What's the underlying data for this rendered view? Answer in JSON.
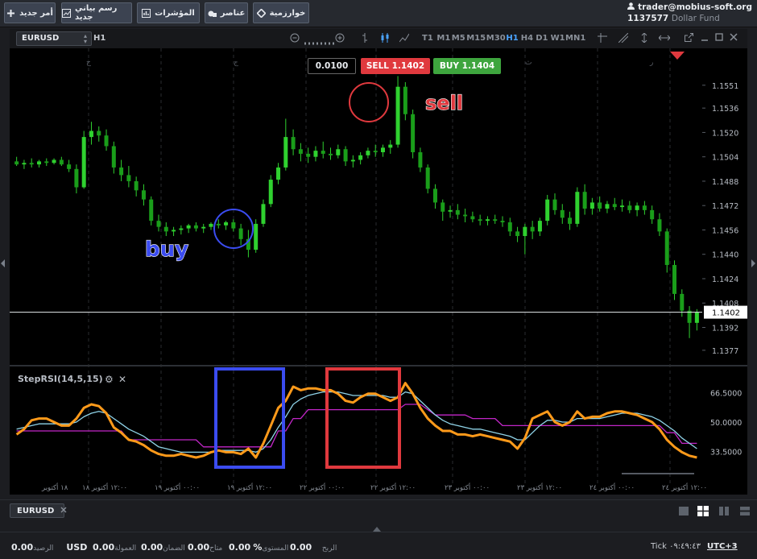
{
  "topbar": {
    "buttons": [
      {
        "label": "أمر جديد",
        "icon": "plus-icon"
      },
      {
        "label": "رسم بياني جديد",
        "icon": "chart-window-icon"
      },
      {
        "label": "المؤشرات",
        "icon": "bar-chart-icon"
      },
      {
        "label": "عناصر",
        "icon": "shapes-icon"
      },
      {
        "label": "خوارزمية",
        "icon": "diamond-icon"
      }
    ],
    "account": {
      "user": "trader@mobius-soft.org",
      "balance": "1137577",
      "fund": "Dollar Fund"
    }
  },
  "chart_toolbar": {
    "symbol": "EURUSD",
    "period": "H1",
    "timeframes": [
      "T1",
      "M1",
      "M5",
      "M15",
      "M30",
      "H1",
      "H4",
      "D1",
      "W1",
      "MN1"
    ],
    "active_timeframe": "H1"
  },
  "order": {
    "lot": "0.0100",
    "sell_label": "SELL 1.1402",
    "buy_label": "BUY 1.1404",
    "sell_color": "#e0393e",
    "buy_color": "#3ea53e"
  },
  "price_axis": {
    "ticks": [
      "1.1551",
      "1.1536",
      "1.1520",
      "1.1504",
      "1.1488",
      "1.1472",
      "1.1456",
      "1.1440",
      "1.1424",
      "1.1408",
      "1.1392",
      "1.1377"
    ],
    "current_price": "1.1402"
  },
  "annotations": {
    "buy": "buy",
    "sell": "sell",
    "buy_color": "#3b4cf0",
    "sell_color": "#e0393e"
  },
  "indicator": {
    "name": "StepRSI(14,5,15)",
    "levels": [
      "66.5000",
      "50.0000",
      "33.5000"
    ]
  },
  "time_axis": [
    "١٨ أكتوبر",
    "١٢:٠٠ أكتوبر ١٨",
    "٠٠:٠٠ أكتوبر ١٩",
    "١٢:٠٠ أكتوبر ١٩",
    "٠٠:٠٠ أكتوبر ٢٢",
    "١٢:٠٠ أكتوبر ٢٢",
    "٠٠:٠٠ أكتوبر ٢٣",
    "١٢:٠٠ أكتوبر ٢٣",
    "٠٠:٠٠ أكتوبر ٢٤",
    "١٢:٠٠ أكتوبر ٢٤"
  ],
  "day_markers": [
    "خ",
    "ج",
    "ن",
    "ث",
    "ر"
  ],
  "tabs": [
    {
      "label": "EURUSD"
    }
  ],
  "status": {
    "balance_label": "الرصيد",
    "balance": "0.00",
    "currency": "USD",
    "commission_label": "العمولة",
    "commission": "0.00",
    "margin_label": "الضمان",
    "margin": "0.00",
    "free_label": "متاح",
    "free": "0.00",
    "level_label": "المستوى",
    "level": "%",
    "profit_label": "الربح",
    "profit": "0.00",
    "tick_label": "Tick",
    "tick_time": "٠٩:٤٩:٤٣",
    "timezone": "UTC+3"
  },
  "chart_data": {
    "type": "candlestick",
    "symbol": "EURUSD",
    "timeframe": "H1",
    "ylim": [
      1.1369,
      1.1562
    ],
    "candles": [
      [
        1.1501,
        1.1504,
        1.1498,
        1.1499
      ],
      [
        1.1499,
        1.1502,
        1.1496,
        1.15
      ],
      [
        1.15,
        1.1503,
        1.1497,
        1.1499
      ],
      [
        1.1499,
        1.1502,
        1.1497,
        1.1501
      ],
      [
        1.1501,
        1.1503,
        1.1498,
        1.15
      ],
      [
        1.15,
        1.1503,
        1.1499,
        1.1502
      ],
      [
        1.1502,
        1.1504,
        1.1498,
        1.1499
      ],
      [
        1.1499,
        1.1502,
        1.1494,
        1.1496
      ],
      [
        1.1496,
        1.1499,
        1.148,
        1.1484
      ],
      [
        1.1484,
        1.1521,
        1.1483,
        1.1517
      ],
      [
        1.1517,
        1.1527,
        1.1512,
        1.1521
      ],
      [
        1.1521,
        1.1524,
        1.1514,
        1.1518
      ],
      [
        1.1518,
        1.1522,
        1.1508,
        1.1511
      ],
      [
        1.1511,
        1.1514,
        1.1493,
        1.1497
      ],
      [
        1.1497,
        1.1502,
        1.1488,
        1.1492
      ],
      [
        1.1492,
        1.1498,
        1.1484,
        1.1488
      ],
      [
        1.1488,
        1.1491,
        1.1478,
        1.1482
      ],
      [
        1.1482,
        1.1486,
        1.1472,
        1.1476
      ],
      [
        1.1476,
        1.1478,
        1.1459,
        1.1462
      ],
      [
        1.1462,
        1.1466,
        1.1455,
        1.1458
      ],
      [
        1.1458,
        1.1461,
        1.1452,
        1.1455
      ],
      [
        1.1455,
        1.1458,
        1.1452,
        1.1456
      ],
      [
        1.1456,
        1.1459,
        1.1453,
        1.1457
      ],
      [
        1.1457,
        1.146,
        1.1454,
        1.1459
      ],
      [
        1.1459,
        1.1461,
        1.1455,
        1.1457
      ],
      [
        1.1457,
        1.146,
        1.1454,
        1.1458
      ],
      [
        1.1458,
        1.1461,
        1.1456,
        1.146
      ],
      [
        1.146,
        1.1463,
        1.1457,
        1.1459
      ],
      [
        1.1459,
        1.1462,
        1.1456,
        1.1461
      ],
      [
        1.1461,
        1.1463,
        1.1455,
        1.1457
      ],
      [
        1.1457,
        1.146,
        1.1446,
        1.145
      ],
      [
        1.145,
        1.1456,
        1.1438,
        1.1443
      ],
      [
        1.1443,
        1.1463,
        1.1441,
        1.146
      ],
      [
        1.146,
        1.1476,
        1.1458,
        1.1473
      ],
      [
        1.1473,
        1.1492,
        1.1471,
        1.1489
      ],
      [
        1.1489,
        1.15,
        1.1486,
        1.1497
      ],
      [
        1.1497,
        1.1529,
        1.1495,
        1.1517
      ],
      [
        1.1517,
        1.1522,
        1.1505,
        1.1509
      ],
      [
        1.1509,
        1.1513,
        1.1501,
        1.1506
      ],
      [
        1.1506,
        1.151,
        1.15,
        1.1504
      ],
      [
        1.1504,
        1.1511,
        1.1501,
        1.1508
      ],
      [
        1.1508,
        1.1514,
        1.1503,
        1.1506
      ],
      [
        1.1506,
        1.151,
        1.1502,
        1.1505
      ],
      [
        1.1505,
        1.1512,
        1.1503,
        1.1509
      ],
      [
        1.1509,
        1.1511,
        1.1498,
        1.1501
      ],
      [
        1.1501,
        1.1505,
        1.1497,
        1.1502
      ],
      [
        1.1502,
        1.1507,
        1.1499,
        1.1505
      ],
      [
        1.1505,
        1.151,
        1.1503,
        1.1508
      ],
      [
        1.1508,
        1.1512,
        1.1504,
        1.1507
      ],
      [
        1.1507,
        1.1512,
        1.1504,
        1.151
      ],
      [
        1.151,
        1.1515,
        1.1506,
        1.1512
      ],
      [
        1.1512,
        1.1557,
        1.151,
        1.155
      ],
      [
        1.155,
        1.1553,
        1.1528,
        1.1532
      ],
      [
        1.1532,
        1.1535,
        1.1503,
        1.1507
      ],
      [
        1.1507,
        1.151,
        1.1494,
        1.1497
      ],
      [
        1.1497,
        1.1499,
        1.148,
        1.1483
      ],
      [
        1.1483,
        1.1486,
        1.147,
        1.1474
      ],
      [
        1.1474,
        1.1476,
        1.1462,
        1.1468
      ],
      [
        1.1468,
        1.1472,
        1.1464,
        1.1469
      ],
      [
        1.1469,
        1.1473,
        1.1463,
        1.1466
      ],
      [
        1.1466,
        1.147,
        1.1461,
        1.1465
      ],
      [
        1.1465,
        1.1468,
        1.1461,
        1.1463
      ],
      [
        1.1463,
        1.1466,
        1.1459,
        1.1462
      ],
      [
        1.1462,
        1.1465,
        1.1459,
        1.1463
      ],
      [
        1.1463,
        1.1466,
        1.146,
        1.1462
      ],
      [
        1.1462,
        1.1465,
        1.1458,
        1.1461
      ],
      [
        1.1461,
        1.1464,
        1.1452,
        1.1455
      ],
      [
        1.1455,
        1.1458,
        1.1448,
        1.1452
      ],
      [
        1.1452,
        1.146,
        1.144,
        1.1458
      ],
      [
        1.1458,
        1.1462,
        1.145,
        1.1455
      ],
      [
        1.1455,
        1.1464,
        1.1452,
        1.1462
      ],
      [
        1.1462,
        1.1479,
        1.1459,
        1.1476
      ],
      [
        1.1476,
        1.148,
        1.1466,
        1.1469
      ],
      [
        1.1469,
        1.1473,
        1.146,
        1.1464
      ],
      [
        1.1464,
        1.1468,
        1.1456,
        1.146
      ],
      [
        1.146,
        1.1484,
        1.1458,
        1.1481
      ],
      [
        1.1481,
        1.1486,
        1.1466,
        1.147
      ],
      [
        1.147,
        1.1477,
        1.1466,
        1.1474
      ],
      [
        1.1474,
        1.1478,
        1.1468,
        1.147
      ],
      [
        1.147,
        1.1475,
        1.1467,
        1.1473
      ],
      [
        1.1473,
        1.1477,
        1.1469,
        1.1471
      ],
      [
        1.1471,
        1.1476,
        1.1468,
        1.1472
      ],
      [
        1.1472,
        1.1475,
        1.1467,
        1.1469
      ],
      [
        1.1469,
        1.1474,
        1.1465,
        1.1472
      ],
      [
        1.1472,
        1.1475,
        1.1466,
        1.1469
      ],
      [
        1.1469,
        1.1472,
        1.146,
        1.1463
      ],
      [
        1.1463,
        1.1467,
        1.1452,
        1.1455
      ],
      [
        1.1455,
        1.1457,
        1.1428,
        1.1433
      ],
      [
        1.1433,
        1.1436,
        1.141,
        1.1414
      ],
      [
        1.1414,
        1.1417,
        1.1399,
        1.1403
      ],
      [
        1.1403,
        1.1406,
        1.1385,
        1.1395
      ],
      [
        1.1395,
        1.1404,
        1.139,
        1.1402
      ]
    ],
    "rsi_fast": [
      43,
      46,
      51,
      52,
      52,
      50,
      48,
      48,
      52,
      58,
      60,
      59,
      55,
      47,
      44,
      40,
      39,
      37,
      34,
      32,
      31,
      31,
      32,
      31,
      30,
      31,
      33,
      34,
      33,
      33,
      32,
      35,
      30,
      38,
      48,
      58,
      62,
      70,
      68,
      69,
      69,
      68,
      68,
      66,
      62,
      61,
      64,
      66,
      66,
      64,
      62,
      64,
      72,
      66,
      58,
      52,
      48,
      45,
      45,
      43,
      43,
      42,
      43,
      42,
      41,
      40,
      39,
      35,
      41,
      52,
      54,
      56,
      50,
      48,
      50,
      56,
      52,
      53,
      53,
      55,
      56,
      56,
      55,
      54,
      52,
      50,
      46,
      40,
      36,
      33,
      31,
      30
    ],
    "rsi_slow": [
      46,
      47,
      48,
      49,
      49,
      49,
      49,
      49,
      50,
      53,
      55,
      56,
      55,
      52,
      49,
      46,
      44,
      42,
      39,
      36,
      35,
      34,
      33,
      33,
      33,
      33,
      33,
      34,
      34,
      34,
      34,
      34,
      33,
      35,
      40,
      47,
      53,
      60,
      63,
      65,
      66,
      67,
      67,
      67,
      66,
      65,
      65,
      65,
      65,
      65,
      64,
      64,
      67,
      66,
      62,
      58,
      54,
      51,
      49,
      48,
      47,
      46,
      46,
      45,
      44,
      43,
      42,
      40,
      40,
      44,
      48,
      51,
      51,
      50,
      50,
      52,
      52,
      52,
      52,
      53,
      54,
      55,
      55,
      55,
      54,
      53,
      51,
      48,
      45,
      41,
      38,
      35
    ],
    "rsi_step": [
      45,
      45,
      45,
      45,
      45,
      45,
      45,
      45,
      45,
      45,
      45,
      45,
      45,
      45,
      45,
      40,
      40,
      40,
      40,
      40,
      40,
      40,
      40,
      40,
      40,
      36,
      36,
      36,
      36,
      36,
      36,
      36,
      36,
      36,
      36,
      45,
      45,
      52,
      52,
      57,
      57,
      57,
      57,
      57,
      57,
      57,
      57,
      57,
      57,
      57,
      57,
      57,
      60,
      60,
      60,
      57,
      54,
      54,
      54,
      54,
      54,
      52,
      52,
      52,
      52,
      48,
      48,
      48,
      48,
      48,
      48,
      48,
      48,
      48,
      48,
      48,
      48,
      48,
      48,
      48,
      48,
      48,
      48,
      48,
      48,
      48,
      48,
      44,
      44,
      38,
      38,
      38
    ],
    "rsi_ylim": [
      20,
      80
    ],
    "rsi_levels": [
      66.5,
      50.0,
      33.5
    ]
  }
}
